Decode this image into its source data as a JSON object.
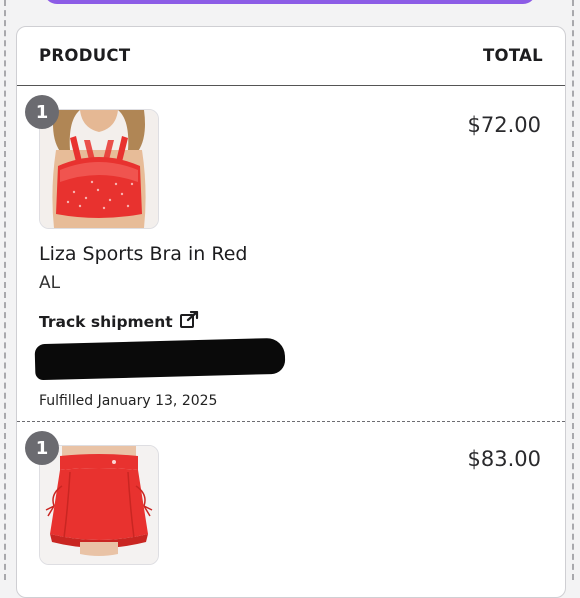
{
  "header": {
    "product_label": "PRODUCT",
    "total_label": "TOTAL"
  },
  "items": [
    {
      "quantity": "1",
      "image": "red sports bra product photo",
      "price": "$72.00",
      "title": "Liza Sports Bra in Red",
      "variant": "AL",
      "track_label": "Track shipment",
      "track_icon": "external-link-icon",
      "fulfilled": "Fulfilled January 13, 2025"
    },
    {
      "quantity": "1",
      "image": "red skort product photo",
      "price": "$83.00"
    }
  ],
  "colors": {
    "accent": "#8c5ce6",
    "product_red": "#e8322f",
    "badge": "#6b6b70"
  }
}
